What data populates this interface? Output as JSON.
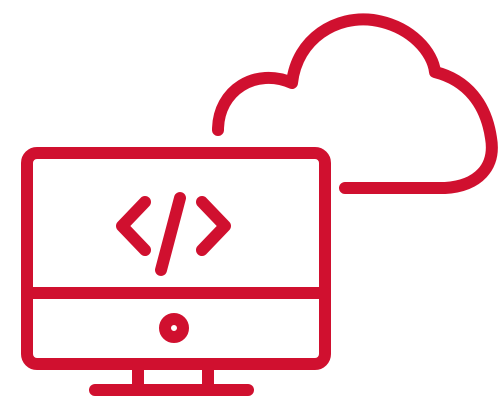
{
  "illustration": {
    "icons": [
      "cloud-icon",
      "monitor-icon",
      "code-icon",
      "power-button-icon",
      "stand-icon"
    ],
    "colors": {
      "stroke": "#d0102f",
      "background": "#ffffff"
    }
  }
}
